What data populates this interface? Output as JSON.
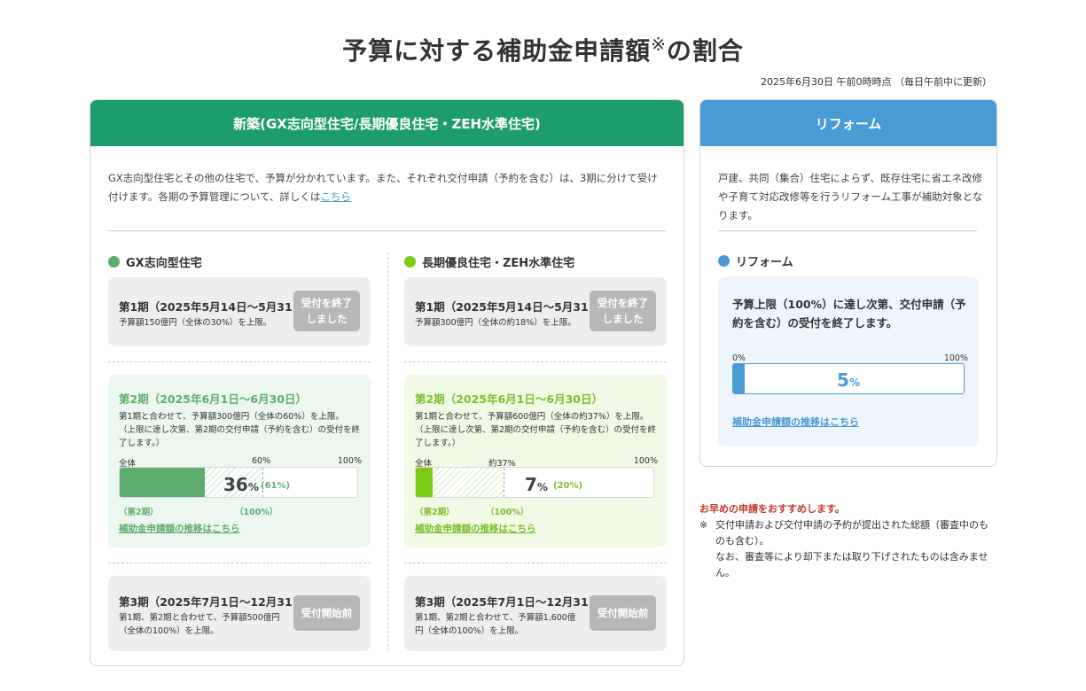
{
  "header": {
    "title": "予算に対する補助金申請額",
    "title_mark": "※",
    "title_suffix": "の割合",
    "timestamp": "2025年6月30日 午前0時時点 （毎日午前中に更新）"
  },
  "new_build": {
    "heading": "新築(GX志向型住宅/長期優良住宅・ZEH水準住宅)",
    "intro": "GX志向型住宅とその他の住宅で、予算が分かれています。また、それぞれ交付申請（予約を含む）は、3期に分けて受け付けます。各期の予算管理について、詳しくは",
    "intro_link": "こちら",
    "gx": {
      "title": "GX志向型住宅",
      "p1": {
        "period": "第1期（2025年5月14日〜5月31日）",
        "note": "予算額150億円（全体の30%）を上限。",
        "status": "受付を終了しました"
      },
      "p2": {
        "period": "第2期（2025年6月1日〜6月30日）",
        "note": "第1期と合わせて、予算額300億円（全体の60%）を上限。\n（上限に達し次第、第2期の交付申請（予約を含む）の受付を終了します。）",
        "label_all": "全体",
        "label_cap": "60%",
        "label_max": "100%",
        "progress_value": "36",
        "progress_unit": "%",
        "period_pct": "(61%)",
        "under_left": "（第2期）",
        "under_right": "（100%）",
        "link": "補助金申請額の推移はこちら"
      },
      "p3": {
        "period": "第3期（2025年7月1日〜12月31日）",
        "note": "第1期、第2期と合わせて、予算額500億円（全体の100%）を上限。",
        "status": "受付開始前"
      }
    },
    "zeh": {
      "title": "長期優良住宅・ZEH水準住宅",
      "p1": {
        "period": "第1期（2025年5月14日〜5月31日）",
        "note": "予算額300億円（全体の約18%）を上限。",
        "status": "受付を終了しました"
      },
      "p2": {
        "period": "第2期（2025年6月1日〜6月30日）",
        "note": "第1期と合わせて、予算額600億円（全体の約37%）を上限。\n（上限に達し次第、第2期の交付申請（予約を含む）の受付を終了します。）",
        "label_all": "全体",
        "label_cap": "約37%",
        "label_max": "100%",
        "progress_value": "7",
        "progress_unit": "%",
        "period_pct": "(20%)",
        "under_left": "（第2期）",
        "under_right": "（100%）",
        "link": "補助金申請額の推移はこちら"
      },
      "p3": {
        "period": "第3期（2025年7月1日〜12月31日）",
        "note": "第1期、第2期と合わせて、予算額1,600億円（全体の100%）を上限。",
        "status": "受付開始前"
      }
    }
  },
  "reform": {
    "heading": "リフォーム",
    "intro": "戸建、共同（集合）住宅によらず、既存住宅に省エネ改修や子育て対応改修等を行うリフォーム工事が補助対象となります。",
    "title": "リフォーム",
    "note": "予算上限（100%）に達し次第、交付申請（予約を含む）の受付を終了します。",
    "label_min": "0%",
    "label_max": "100%",
    "progress_value": "5",
    "progress_unit": "%",
    "link": "補助金申請額の推移はこちら"
  },
  "footer": {
    "recommend": "お早めの申請をおすすめします。",
    "note_mark": "※",
    "note": "交付申請および交付申請の予約が提出された総額（審査中のものも含む）。\nなお、審査等により却下または取り下げされたものは含みません。"
  },
  "colors": {
    "green_header": "#1d9d6c",
    "gx": "#5fad6e",
    "zeh": "#7dcb14",
    "reform": "#4a9ad3",
    "recommend": "#c8372d"
  },
  "progress": {
    "gx_overall_fraction": 0.36,
    "gx_cap_fraction": 0.6,
    "zeh_overall_fraction": 0.07,
    "zeh_cap_fraction": 0.37,
    "reform_fraction": 0.05
  }
}
